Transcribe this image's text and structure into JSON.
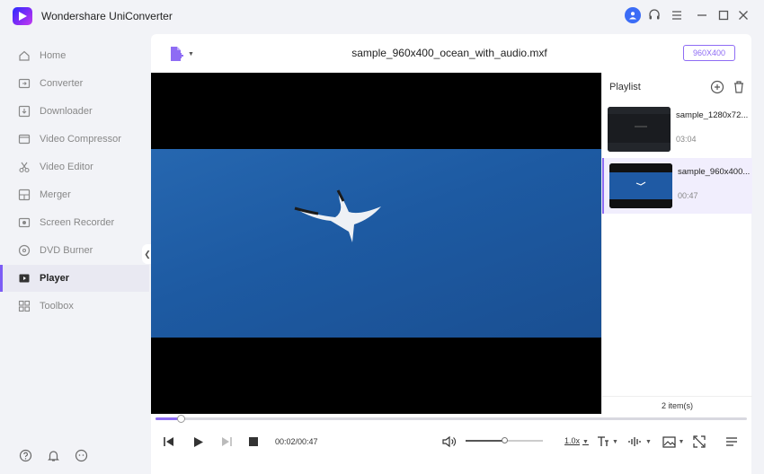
{
  "app": {
    "title": "Wondershare UniConverter"
  },
  "titlebar": {
    "icons": [
      "user-icon",
      "headset-icon",
      "menu-icon",
      "minimize-icon",
      "maximize-icon",
      "close-icon"
    ]
  },
  "sidebar": {
    "items": [
      {
        "label": "Home",
        "icon": "home-icon"
      },
      {
        "label": "Converter",
        "icon": "converter-icon"
      },
      {
        "label": "Downloader",
        "icon": "download-icon"
      },
      {
        "label": "Video Compressor",
        "icon": "compress-icon"
      },
      {
        "label": "Video Editor",
        "icon": "scissors-icon"
      },
      {
        "label": "Merger",
        "icon": "merge-icon"
      },
      {
        "label": "Screen Recorder",
        "icon": "record-icon"
      },
      {
        "label": "DVD Burner",
        "icon": "dvd-icon"
      },
      {
        "label": "Player",
        "icon": "player-icon",
        "active": true
      },
      {
        "label": "Toolbox",
        "icon": "toolbox-icon"
      }
    ],
    "bottom_icons": [
      "help-icon",
      "bell-icon",
      "feedback-icon"
    ]
  },
  "player": {
    "file_title": "sample_960x400_ocean_with_audio.mxf",
    "resolution_badge": "960X400",
    "current_time": "00:02",
    "duration": "00:47",
    "time_display": "00:02/00:47",
    "progress_fraction": 0.043,
    "volume_fraction": 0.5,
    "speed": "1.0x"
  },
  "playlist": {
    "header": "Playlist",
    "items": [
      {
        "name": "sample_1280x72...",
        "duration": "03:04",
        "active": false
      },
      {
        "name": "sample_960x400...",
        "duration": "00:47",
        "active": true
      }
    ],
    "count_label": "2 item(s)"
  },
  "colors": {
    "accent": "#8e6cf4",
    "video_sea": "#1f5aa4"
  }
}
